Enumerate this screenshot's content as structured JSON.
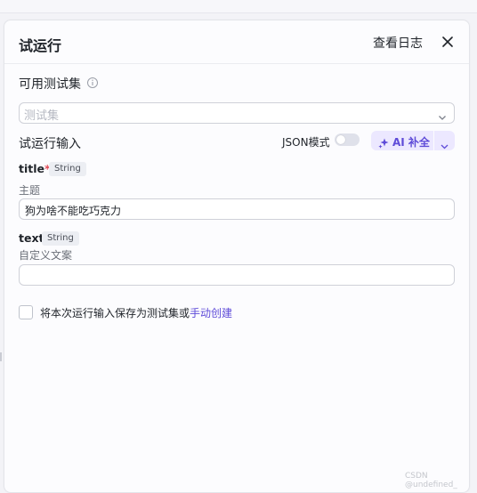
{
  "panel": {
    "title": "试运行",
    "view_log": "查看日志"
  },
  "testset": {
    "label": "可用测试集",
    "placeholder": "测试集"
  },
  "run_input": {
    "label": "试运行输入",
    "json_mode_label": "JSON模式",
    "json_mode_on": false,
    "ai_button_label": "AI 补全"
  },
  "fields": [
    {
      "name": "title",
      "required_mark": "*",
      "type": "String",
      "description": "主题",
      "value": "狗为啥不能吃巧克力"
    },
    {
      "name": "text",
      "type": "String",
      "description": "自定义文案",
      "value": ""
    }
  ],
  "save": {
    "text": "将本次运行输入保存为测试集或",
    "link": "手动创建"
  },
  "watermark": "CSDN @undefined_",
  "colors": {
    "accent": "#5e4bd8",
    "accent_bg": "#ece8ff",
    "required": "#e34d59"
  }
}
